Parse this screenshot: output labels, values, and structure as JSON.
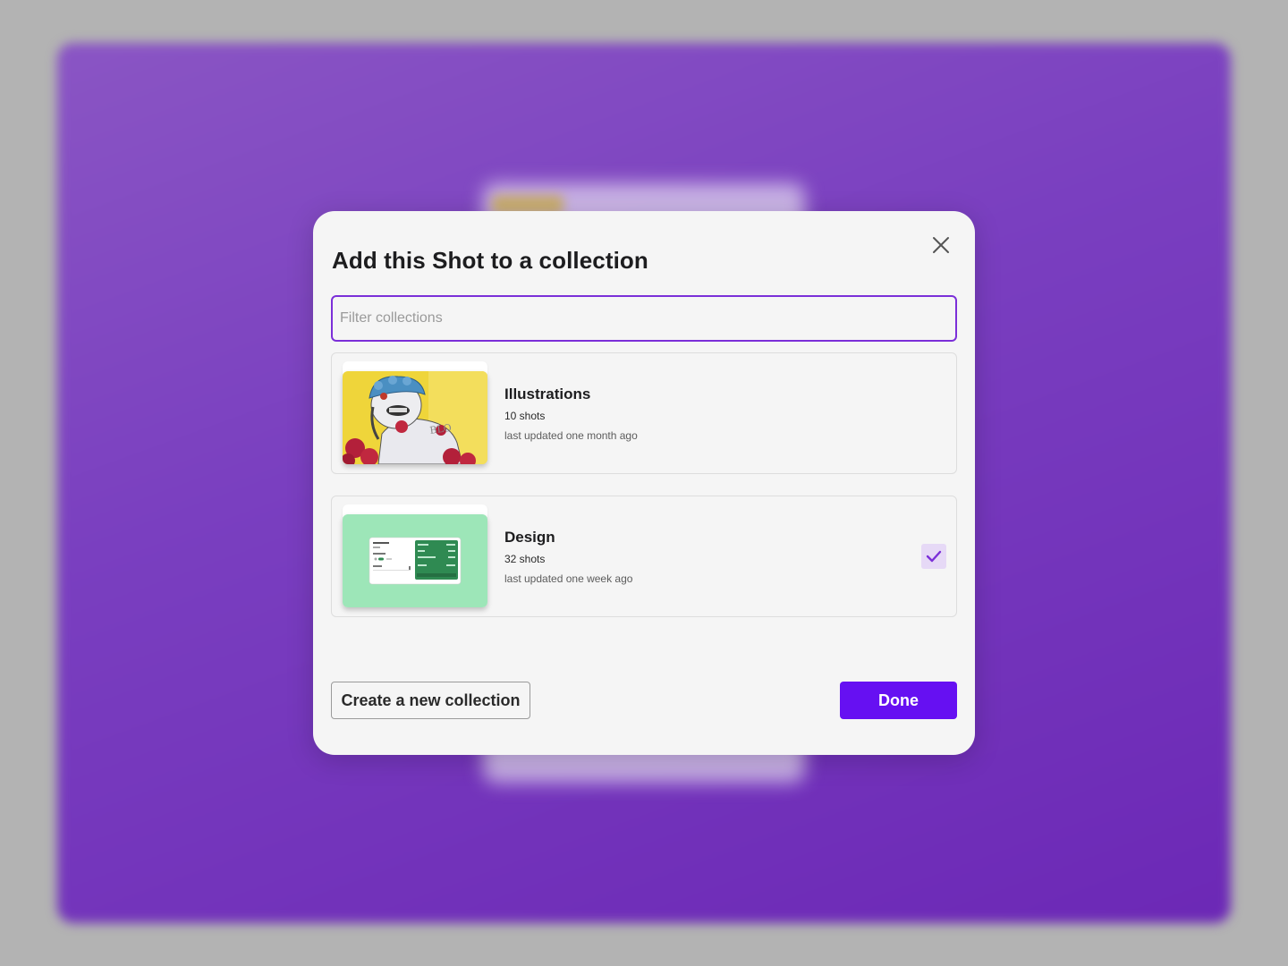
{
  "modal": {
    "title": "Add this Shot to a collection",
    "close_icon": "close-icon"
  },
  "search": {
    "placeholder": "Filter collections",
    "value": ""
  },
  "collections": [
    {
      "name": "Illustrations",
      "count": "10 shots",
      "updated": "last updated one month ago",
      "selected": false,
      "thumbnail": "illustration-thumbnail"
    },
    {
      "name": "Design",
      "count": "32 shots",
      "updated": "last updated one week ago",
      "selected": true,
      "thumbnail": "design-thumbnail"
    }
  ],
  "footer": {
    "create_label": "Create a new collection",
    "done_label": "Done"
  },
  "colors": {
    "accent": "#6610f2",
    "input_border": "#7b2fd8",
    "backdrop": "#7a3fc0",
    "checkbox_bg": "#e6d9f6",
    "design_thumb_bg": "#9de6b8",
    "illustration_thumb_bg": "#efd53a"
  }
}
